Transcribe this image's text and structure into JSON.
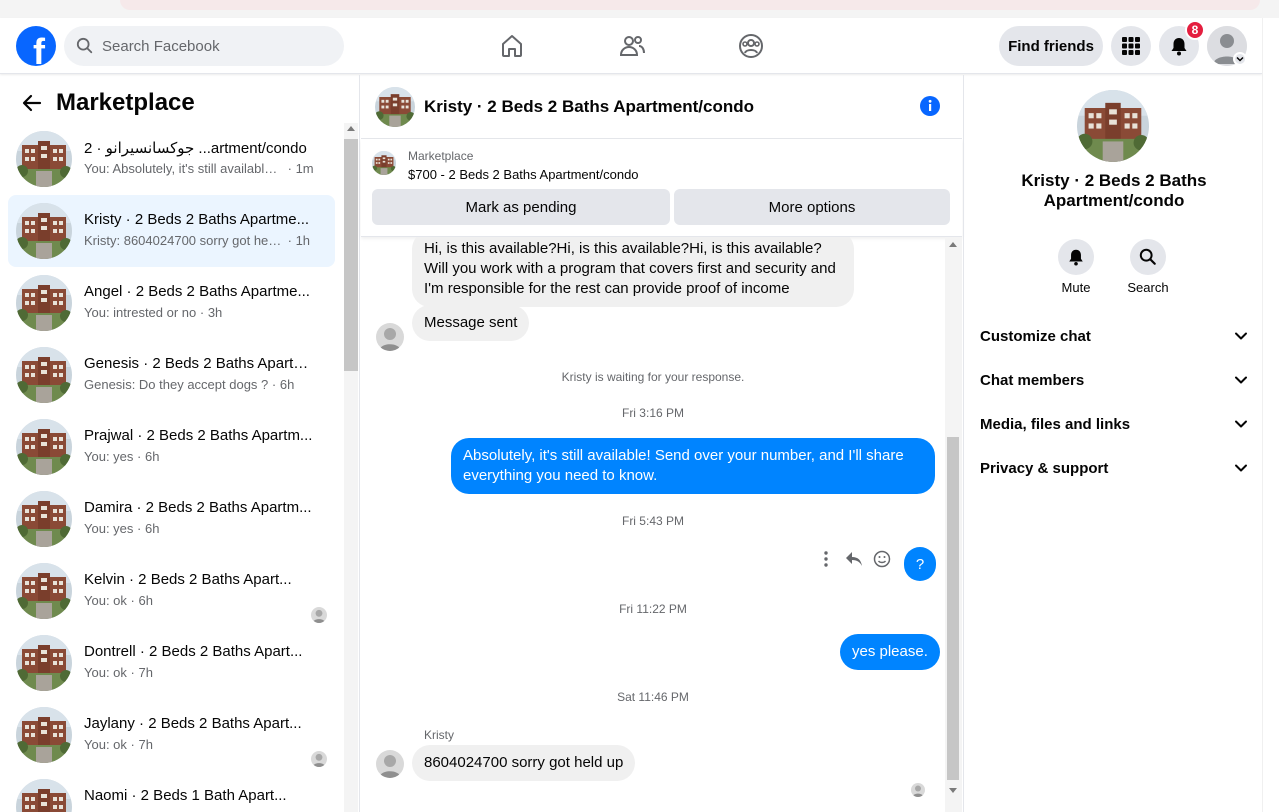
{
  "header": {
    "search_placeholder": "Search Facebook",
    "find_friends_label": "Find friends",
    "notification_count": "8"
  },
  "sidebar": {
    "title": "Marketplace",
    "conversations": [
      {
        "title": "جوكسانسيرانو · 2 ...artment/condo",
        "snippet": "You: Absolutely, it's still available! ...",
        "time": "· 1m",
        "active": false,
        "mini_avatar": false
      },
      {
        "title": "Kristy · 2 Beds 2 Baths Apartme...",
        "snippet": "Kristy: 8604024700 sorry got held ...",
        "time": "· 1h",
        "active": true,
        "mini_avatar": false
      },
      {
        "title": "Angel · 2 Beds 2 Baths Apartme...",
        "snippet": "You: intrested or no",
        "time": "· 3h",
        "active": false,
        "mini_avatar": false
      },
      {
        "title": "Genesis · 2 Beds 2 Baths Apartm...",
        "snippet": "Genesis: Do they accept dogs ?",
        "time": "· 6h",
        "active": false,
        "mini_avatar": false
      },
      {
        "title": "Prajwal · 2 Beds 2 Baths Apartm...",
        "snippet": "You: yes",
        "time": "· 6h",
        "active": false,
        "mini_avatar": false
      },
      {
        "title": "Damira · 2 Beds 2 Baths Apartm...",
        "snippet": "You: yes",
        "time": "· 6h",
        "active": false,
        "mini_avatar": false
      },
      {
        "title": "Kelvin · 2 Beds 2 Baths Apart...",
        "snippet": "You: ok",
        "time": "· 6h",
        "active": false,
        "mini_avatar": true
      },
      {
        "title": "Dontrell · 2 Beds 2 Baths Apart...",
        "snippet": "You: ok",
        "time": "· 7h",
        "active": false,
        "mini_avatar": false
      },
      {
        "title": "Jaylany · 2 Beds 2 Baths Apart...",
        "snippet": "You: ok",
        "time": "· 7h",
        "active": false,
        "mini_avatar": true
      },
      {
        "title": "Naomi · 2 Beds 1 Bath Apart...",
        "snippet": "",
        "time": "",
        "active": false,
        "mini_avatar": true
      }
    ]
  },
  "chat": {
    "title": "Kristy · 2 Beds 2 Baths Apartment/condo",
    "listing_label": "Marketplace",
    "listing_price": "$700 - 2 Beds 2 Baths Apartment/condo",
    "mark_pending_label": "Mark as pending",
    "more_options_label": "More options",
    "msg_1": "Hi, is this available?Hi, is this available?Hi, is this available?Will you work with a program that covers first and security and I'm responsible for the rest can provide proof of income",
    "msg_2": "Message sent",
    "waiting_text": "Kristy is waiting for your response.",
    "time_1": "Fri 3:16 PM",
    "msg_3": "Absolutely, it's still available! Send over your number, and I'll share everything you need to know.",
    "time_2": "Fri 5:43 PM",
    "msg_q": "?",
    "time_3": "Fri 11:22 PM",
    "msg_4": "yes please.",
    "time_4": "Sat 11:46 PM",
    "sender_name": "Kristy",
    "msg_5": "8604024700 sorry got held up"
  },
  "details": {
    "title": "Kristy · 2 Beds 2 Baths Apartment/condo",
    "mute_label": "Mute",
    "search_label": "Search",
    "sections": [
      "Customize chat",
      "Chat members",
      "Media, files and links",
      "Privacy & support"
    ]
  },
  "colors": {
    "brand": "#0866ff",
    "outgoing_bubble": "#0084ff",
    "incoming_bubble": "#f0f0f0",
    "active_row": "#ebf5ff",
    "badge": "#e41e3f"
  }
}
